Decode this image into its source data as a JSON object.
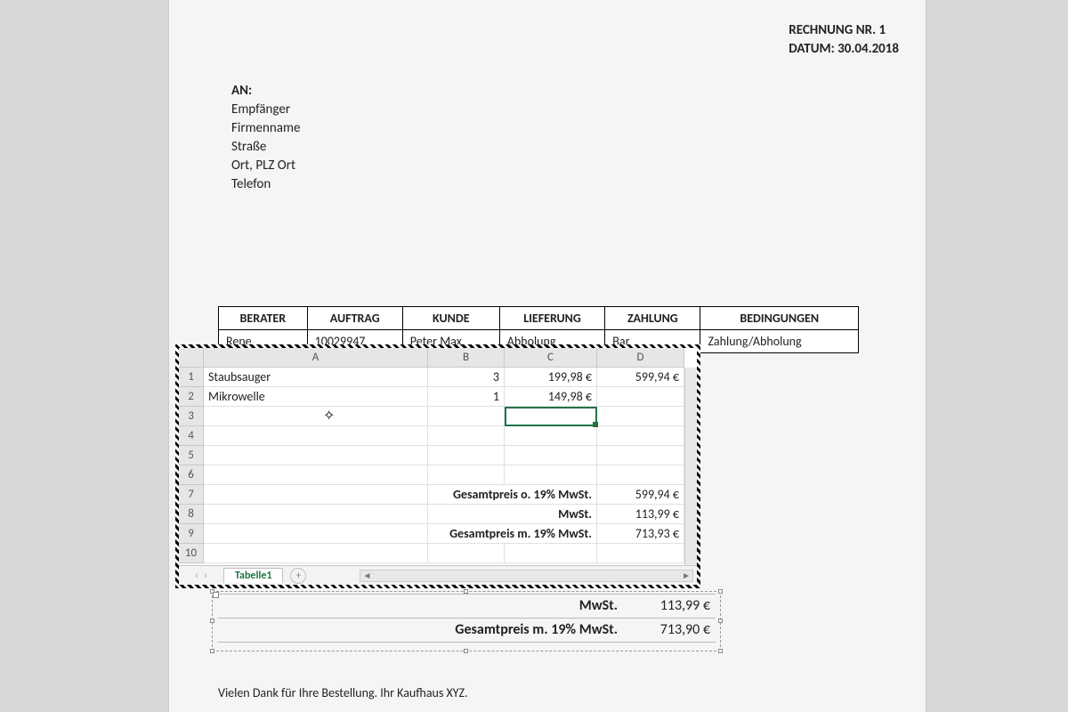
{
  "header": {
    "invoice_no_label": "RECHNUNG NR. 1",
    "date_label": "DATUM: 30.04.2018"
  },
  "recipient": {
    "an": "AN:",
    "l1": "Empfänger",
    "l2": "Firmenname",
    "l3": "Straße",
    "l4": "Ort, PLZ Ort",
    "l5": "Telefon"
  },
  "info": {
    "headers": [
      "BERATER",
      "AUFTRAG",
      "KUNDE",
      "LIEFERUNG",
      "ZAHLUNG",
      "BEDINGUNGEN"
    ],
    "values": [
      "Rene",
      "10029947",
      "Peter Max",
      "Abholung",
      "Bar",
      "Zahlung/Abholung"
    ]
  },
  "excel": {
    "columns": [
      "A",
      "B",
      "C",
      "D"
    ],
    "rows": [
      "1",
      "2",
      "3",
      "4",
      "5",
      "6",
      "7",
      "8",
      "9",
      "10"
    ],
    "cells": {
      "A1": "Staubsauger",
      "B1": "3",
      "C1": "199,98 €",
      "D1": "599,94 €",
      "A2": "Mikrowelle",
      "B2": "1",
      "C2": "149,98 €",
      "D2": "",
      "S7L": "Gesamtpreis o. 19% MwSt.",
      "D7": "599,94 €",
      "S8L": "MwSt.",
      "D8": "113,99 €",
      "S9L": "Gesamtpreis m. 19% MwSt.",
      "D9": "713,93 €"
    },
    "tab": "Tabelle1",
    "selected_cell": "C3"
  },
  "doc_summary": {
    "r1_label": "MwSt.",
    "r1_value": "113,99 €",
    "r2_label": "Gesamtpreis m. 19% MwSt.",
    "r2_value": "713,90 €"
  },
  "footer": "Vielen Dank für Ihre Bestellung. Ihr Kaufhaus XYZ."
}
